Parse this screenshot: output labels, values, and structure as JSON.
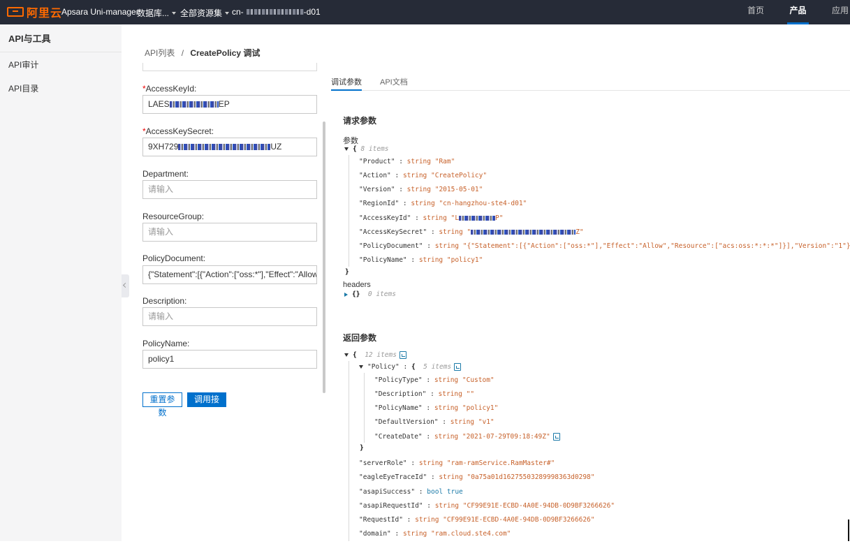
{
  "topbar": {
    "logo_text": "阿里云",
    "brand": "Apsara Uni-manager",
    "menu_db": "数据库...",
    "menu_resources": "全部资源集",
    "region_prefix": "cn-",
    "region_suffix": "-d01",
    "nav_home": "首页",
    "nav_products": "产品",
    "nav_apps": "应用"
  },
  "sidebar": {
    "title": "API与工具",
    "items": [
      {
        "label": "API审计"
      },
      {
        "label": "API目录"
      }
    ]
  },
  "breadcrumb": {
    "root": "API列表",
    "separator": "/",
    "current": "CreatePolicy 调试"
  },
  "form": {
    "access_key_id_label": "AccessKeyId:",
    "access_key_id_value_start": "LAES",
    "access_key_id_value_end": "EP",
    "access_key_secret_label": "AccessKeySecret:",
    "access_key_secret_value_start": "9XH729",
    "access_key_secret_value_end": "UZ",
    "department_label": "Department:",
    "department_placeholder": "请输入",
    "resource_group_label": "ResourceGroup:",
    "resource_group_placeholder": "请输入",
    "policy_document_label": "PolicyDocument:",
    "policy_document_value": "{\"Statement\":[{\"Action\":[\"oss:*\"],\"Effect\":\"Allow\",\"Res",
    "description_label": "Description:",
    "description_placeholder": "请输入",
    "policy_name_label": "PolicyName:",
    "policy_name_value": "policy1",
    "reset_button": "重置参数",
    "call_button": "调用接口"
  },
  "tabs": {
    "debug": "调试参数",
    "docs": "API文档"
  },
  "request": {
    "title": "请求参数",
    "params_label": "参数",
    "params_count": "8 items",
    "rows": [
      {
        "key": "\"Product\"",
        "type": "string",
        "value": "\"Ram\""
      },
      {
        "key": "\"Action\"",
        "type": "string",
        "value": "\"CreatePolicy\""
      },
      {
        "key": "\"Version\"",
        "type": "string",
        "value": "\"2015-05-01\""
      },
      {
        "key": "\"RegionId\"",
        "type": "string",
        "value": "\"cn-hangzhou-ste4-d01\""
      },
      {
        "key": "\"AccessKeyId\"",
        "type": "string",
        "value": "\"L",
        "value_end": "P\""
      },
      {
        "key": "\"AccessKeySecret\"",
        "type": "string",
        "value": "\"",
        "value_end": "Z\""
      },
      {
        "key": "\"PolicyDocument\"",
        "type": "string",
        "value": "\"{\"Statement\":[{\"Action\":[\"oss:*\"],\"Effect\":\"Allow\",\"Resource\":[\"acs:oss:*:*:*\"]}],\"Version\":\"1\"}\""
      },
      {
        "key": "\"PolicyName\"",
        "type": "string",
        "value": "\"policy1\""
      }
    ],
    "headers_label": "headers",
    "headers_braces": "{}",
    "headers_count": "0 items"
  },
  "response": {
    "title": "返回参数",
    "root_count": "12 items",
    "policy_key": "\"Policy\"",
    "policy_count": "5 items",
    "policy_rows": [
      {
        "key": "\"PolicyType\"",
        "type": "string",
        "value": "\"Custom\""
      },
      {
        "key": "\"Description\"",
        "type": "string",
        "value": "\"\""
      },
      {
        "key": "\"PolicyName\"",
        "type": "string",
        "value": "\"policy1\""
      },
      {
        "key": "\"DefaultVersion\"",
        "type": "string",
        "value": "\"v1\""
      },
      {
        "key": "\"CreateDate\"",
        "type": "string",
        "value": "\"2021-07-29T09:18:49Z\""
      }
    ],
    "rows": [
      {
        "key": "\"serverRole\"",
        "type": "string",
        "value": "\"ram-ramService.RamMaster#\""
      },
      {
        "key": "\"eagleEyeTraceId\"",
        "type": "string",
        "value": "\"0a75a01d16275503289998363d0298\""
      },
      {
        "key": "\"asapiSuccess\"",
        "type": "bool",
        "value": "true"
      },
      {
        "key": "\"asapiRequestId\"",
        "type": "string",
        "value": "\"CF99E91E-ECBD-4A0E-94DB-0D9BF3266626\""
      },
      {
        "key": "\"RequestId\"",
        "type": "string",
        "value": "\"CF99E91E-ECBD-4A0E-94DB-0D9BF3266626\""
      },
      {
        "key": "\"domain\"",
        "type": "string",
        "value": "\"ram.cloud.ste4.com\""
      }
    ]
  }
}
